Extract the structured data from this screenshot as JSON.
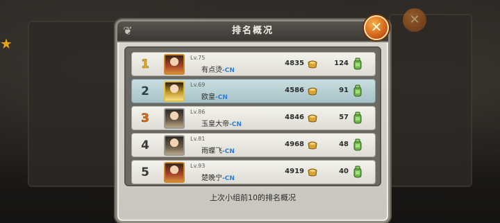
{
  "dialog": {
    "title": "排名概况",
    "footer": "上次小组前10的排名概况",
    "close_label": "✕"
  },
  "colors": {
    "accent_orange": "#d8681e",
    "server_tag": "#2c7fd6",
    "highlight_row": "#a7c3c8"
  },
  "icons": {
    "close": "close-icon",
    "ingot": "gold-ingot-icon",
    "bag": "green-pouch-icon",
    "corner": "cloud-ornament-icon"
  },
  "rankings": [
    {
      "rank": "1",
      "level": "Lv.75",
      "name": "有点烫",
      "server": "-CN",
      "power": "4835",
      "score": "124"
    },
    {
      "rank": "2",
      "level": "Lv.69",
      "name": "欧皇",
      "server": "-CN",
      "power": "4586",
      "score": "91"
    },
    {
      "rank": "3",
      "level": "Lv.86",
      "name": "玉皇大帝",
      "server": "-CN",
      "power": "4846",
      "score": "57"
    },
    {
      "rank": "4",
      "level": "Lv.81",
      "name": "雨蝶飞",
      "server": "-CN",
      "power": "4968",
      "score": "48"
    },
    {
      "rank": "5",
      "level": "Lv.93",
      "name": "楚晚宁",
      "server": "-CN",
      "power": "4919",
      "score": "40"
    }
  ]
}
